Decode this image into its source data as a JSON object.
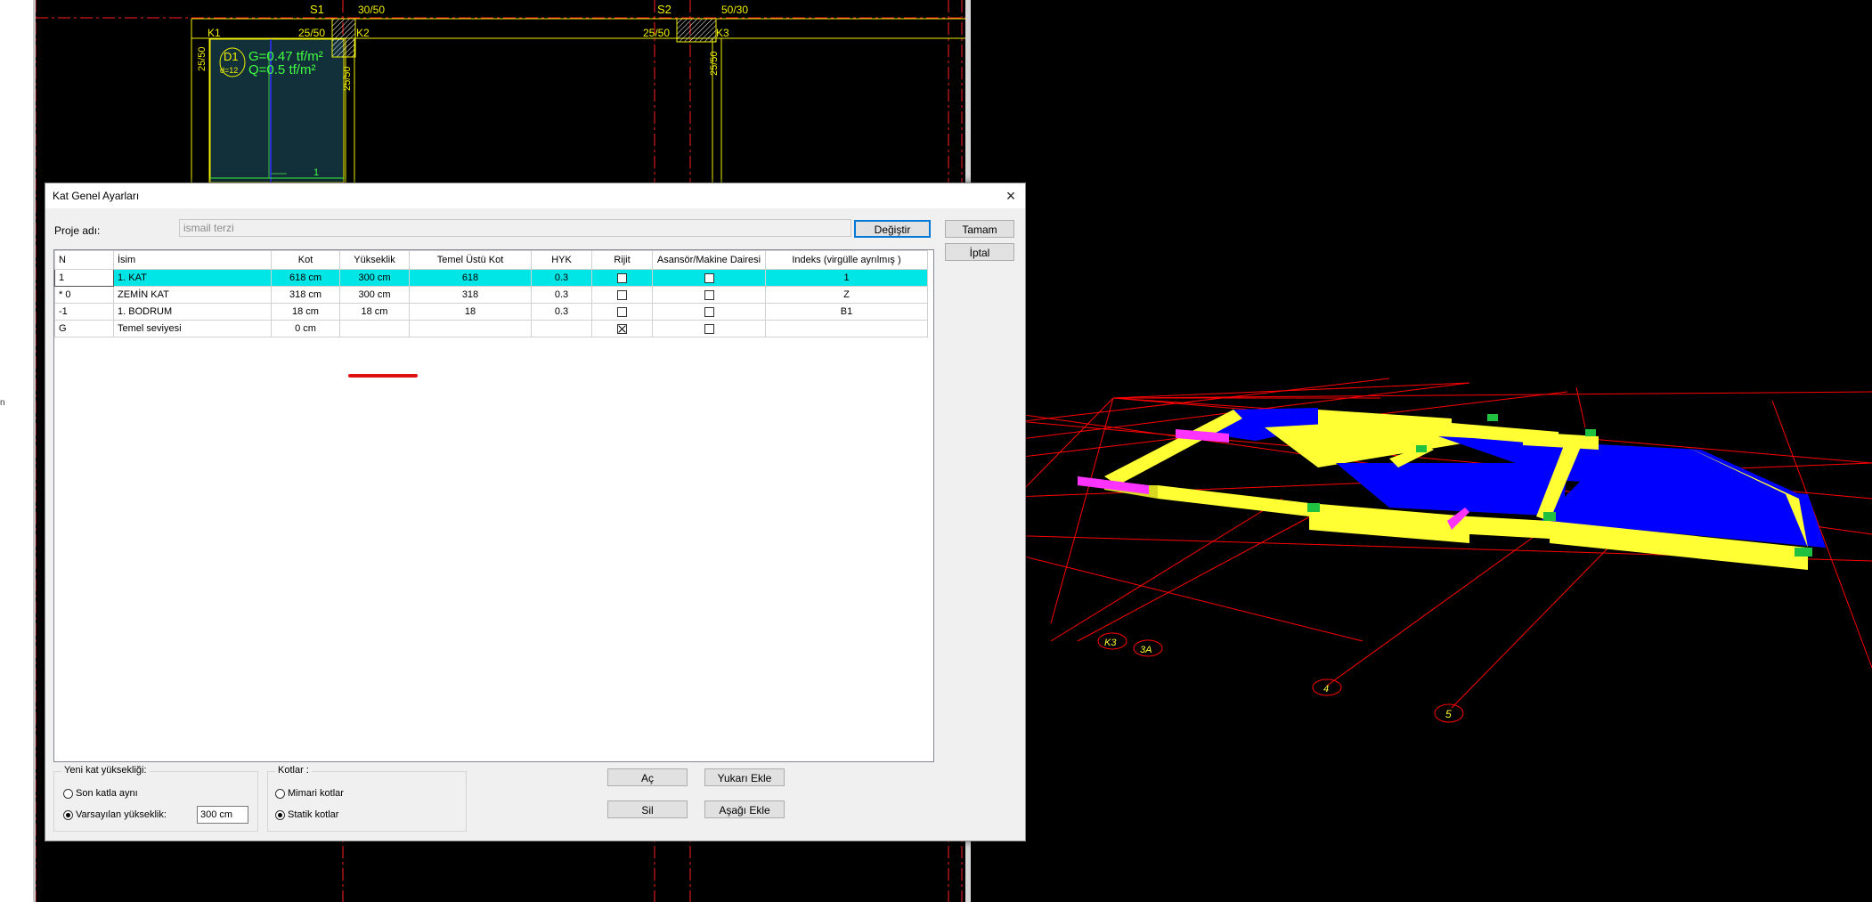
{
  "dialog": {
    "title": "Kat Genel Ayarları",
    "close_icon": "×",
    "project_label": "Proje adı:",
    "project_value": "ismail terzi",
    "change_button": "Değiştir",
    "ok_button": "Tamam",
    "cancel_button": "İptal"
  },
  "table": {
    "headers": [
      "N",
      "İsim",
      "Kot",
      "Yükseklik",
      "Temel Üstü Kot",
      "HYK",
      "Rijit",
      "Asansör/Makine Dairesi",
      "Indeks (virgülle ayrılmış )"
    ],
    "rows": [
      {
        "n": "1",
        "name": "1. KAT",
        "kot": "618 cm",
        "height": "300 cm",
        "temel": "618",
        "hyk": "0.3",
        "rigid": false,
        "elevator": false,
        "index": "1"
      },
      {
        "n": "* 0",
        "name": "ZEMİN KAT",
        "kot": "318 cm",
        "height": "300 cm",
        "temel": "318",
        "hyk": "0.3",
        "rigid": false,
        "elevator": false,
        "index": "Z"
      },
      {
        "n": "-1",
        "name": "1. BODRUM",
        "kot": "18 cm",
        "height": "18 cm",
        "temel": "18",
        "hyk": "0.3",
        "rigid": false,
        "elevator": false,
        "index": "B1"
      },
      {
        "n": "G",
        "name": "Temel seviyesi",
        "kot": "0 cm",
        "height": "",
        "temel": "",
        "hyk": "",
        "rigid": true,
        "elevator": false,
        "index": ""
      }
    ]
  },
  "new_floor": {
    "title": "Yeni kat yüksekliği:",
    "option_same": "Son katla aynı",
    "option_default": "Varsayılan yükseklik:",
    "default_value": "300 cm",
    "selected": "default"
  },
  "levels": {
    "title": "Kotlar :",
    "option_arch": "Mimari kotlar",
    "option_static": "Statik kotlar",
    "selected": "static"
  },
  "actions": {
    "open": "Aç",
    "delete": "Sil",
    "add_above": "Yukarı Ekle",
    "add_below": "Aşağı Ekle"
  },
  "cad_plan": {
    "axis_s1": "S1",
    "axis_s2": "S2",
    "col_30_50": "30/50",
    "col_50_30": "50/30",
    "beam_25_50": "25/50",
    "k1": "K1",
    "k2": "K2",
    "k3": "K3",
    "slab_id": "D1",
    "slab_thickness": "d=12",
    "load_g": "G=0.47 tf/m²",
    "load_q": "Q=0.5 tf/m²",
    "slab_num": "1",
    "colors": {
      "grid": "#ff2020",
      "element": "#f0f000",
      "label_green": "#40ff40"
    }
  },
  "model_3d": {
    "axis_k3": "K3",
    "axis_3a": "3A",
    "axis_4": "4",
    "axis_5": "5",
    "colors": {
      "slab": "#0000ff",
      "beam": "#ffff33",
      "column": "#20c040",
      "highlight": "#ff33ff",
      "axis": "#ff0000"
    }
  },
  "misc": {
    "cursor_glyph": "n"
  }
}
